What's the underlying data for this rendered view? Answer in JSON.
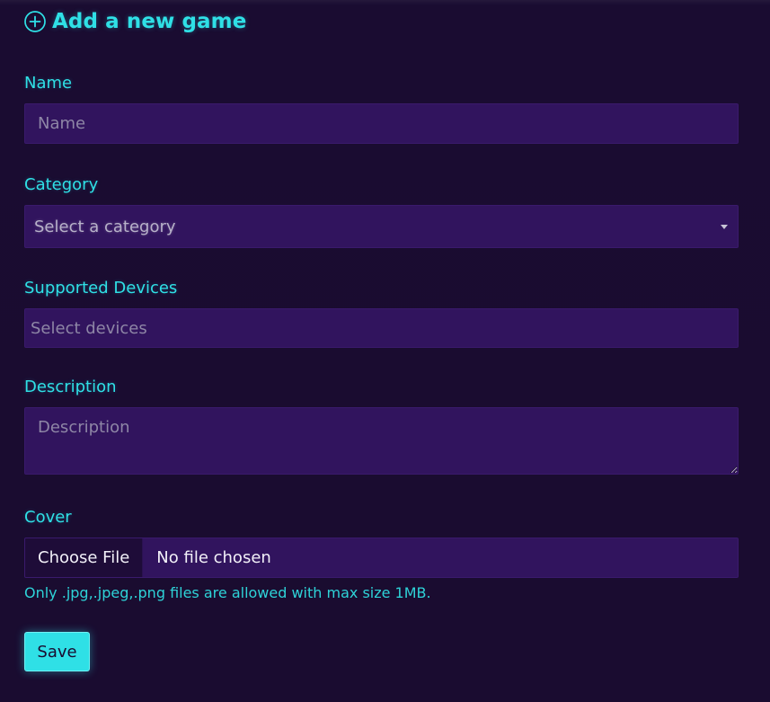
{
  "header": {
    "title": "Add a new game",
    "icon": "plus-circle-icon",
    "accent_color": "#2fe0e6"
  },
  "form": {
    "name": {
      "label": "Name",
      "placeholder": "Name",
      "value": ""
    },
    "category": {
      "label": "Category",
      "selected": "Select a category",
      "icon": "chevron-down-icon"
    },
    "devices": {
      "label": "Supported Devices",
      "placeholder": "Select devices"
    },
    "description": {
      "label": "Description",
      "placeholder": "Description",
      "value": ""
    },
    "cover": {
      "label": "Cover",
      "button_label": "Choose File",
      "status": "No file chosen",
      "hint": "Only .jpg,.jpeg,.png files are allowed with max size 1MB."
    },
    "save_label": "Save"
  },
  "colors": {
    "background": "#1a0c30",
    "input_background": "#31145e",
    "accent": "#2fe0e6"
  }
}
